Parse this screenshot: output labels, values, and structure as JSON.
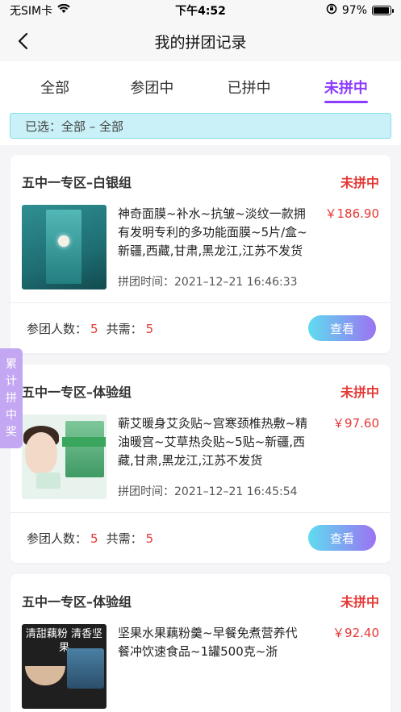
{
  "status_bar": {
    "carrier": "无SIM卡",
    "time": "下午4:52",
    "battery_pct": "97%",
    "battery_fill": 0.97
  },
  "nav": {
    "title": "我的拼团记录"
  },
  "tabs": [
    {
      "label": "全部",
      "active": false
    },
    {
      "label": "参团中",
      "active": false
    },
    {
      "label": "已拼中",
      "active": false
    },
    {
      "label": "未拼中",
      "active": true
    }
  ],
  "filter": {
    "text": "已选：全部 – 全部"
  },
  "side_badge": {
    "chars": [
      "累",
      "计",
      "拼",
      "中",
      "奖"
    ]
  },
  "labels": {
    "time_prefix": "拼团时间：",
    "participants_label": "参团人数：",
    "needed_label": "共需：",
    "view_button": "查看"
  },
  "orders": [
    {
      "group": "五中一专区–白银组",
      "status": "未拼中",
      "title": "神奇面膜~补水~抗皱~淡纹一款拥有发明专利的多功能面膜~5片/盒~新疆,西藏,甘肃,黑龙江,江苏不发货",
      "price": "￥186.90",
      "time": "2021–12–21 16:46:33",
      "participants": "5",
      "needed": "5",
      "thumb": "mask-product-image"
    },
    {
      "group": "五中一专区–体验组",
      "status": "未拼中",
      "title": "蕲艾暖身艾灸贴~宫寒颈椎热敷~精油暖宫~艾草热灸贴~5贴~新疆,西藏,甘肃,黑龙江,江苏不发货",
      "price": "￥97.60",
      "time": "2021–12–21 16:45:54",
      "participants": "5",
      "needed": "5",
      "thumb": "moxa-patch-product-image"
    },
    {
      "group": "五中一专区–体验组",
      "status": "未拼中",
      "title": "坚果水果藕粉羹~早餐免煮营养代餐冲饮速食品~1罐500克~浙",
      "price": "￥92.40",
      "thumb": "lotus-root-powder-product-image",
      "thumb_text": "清甜藕粉 清香坚果"
    }
  ],
  "colors": {
    "accent": "#8b3dff",
    "price_red": "#e53935",
    "filter_bg": "#c9f1f7",
    "badge_bg": "#c3a7f3"
  }
}
